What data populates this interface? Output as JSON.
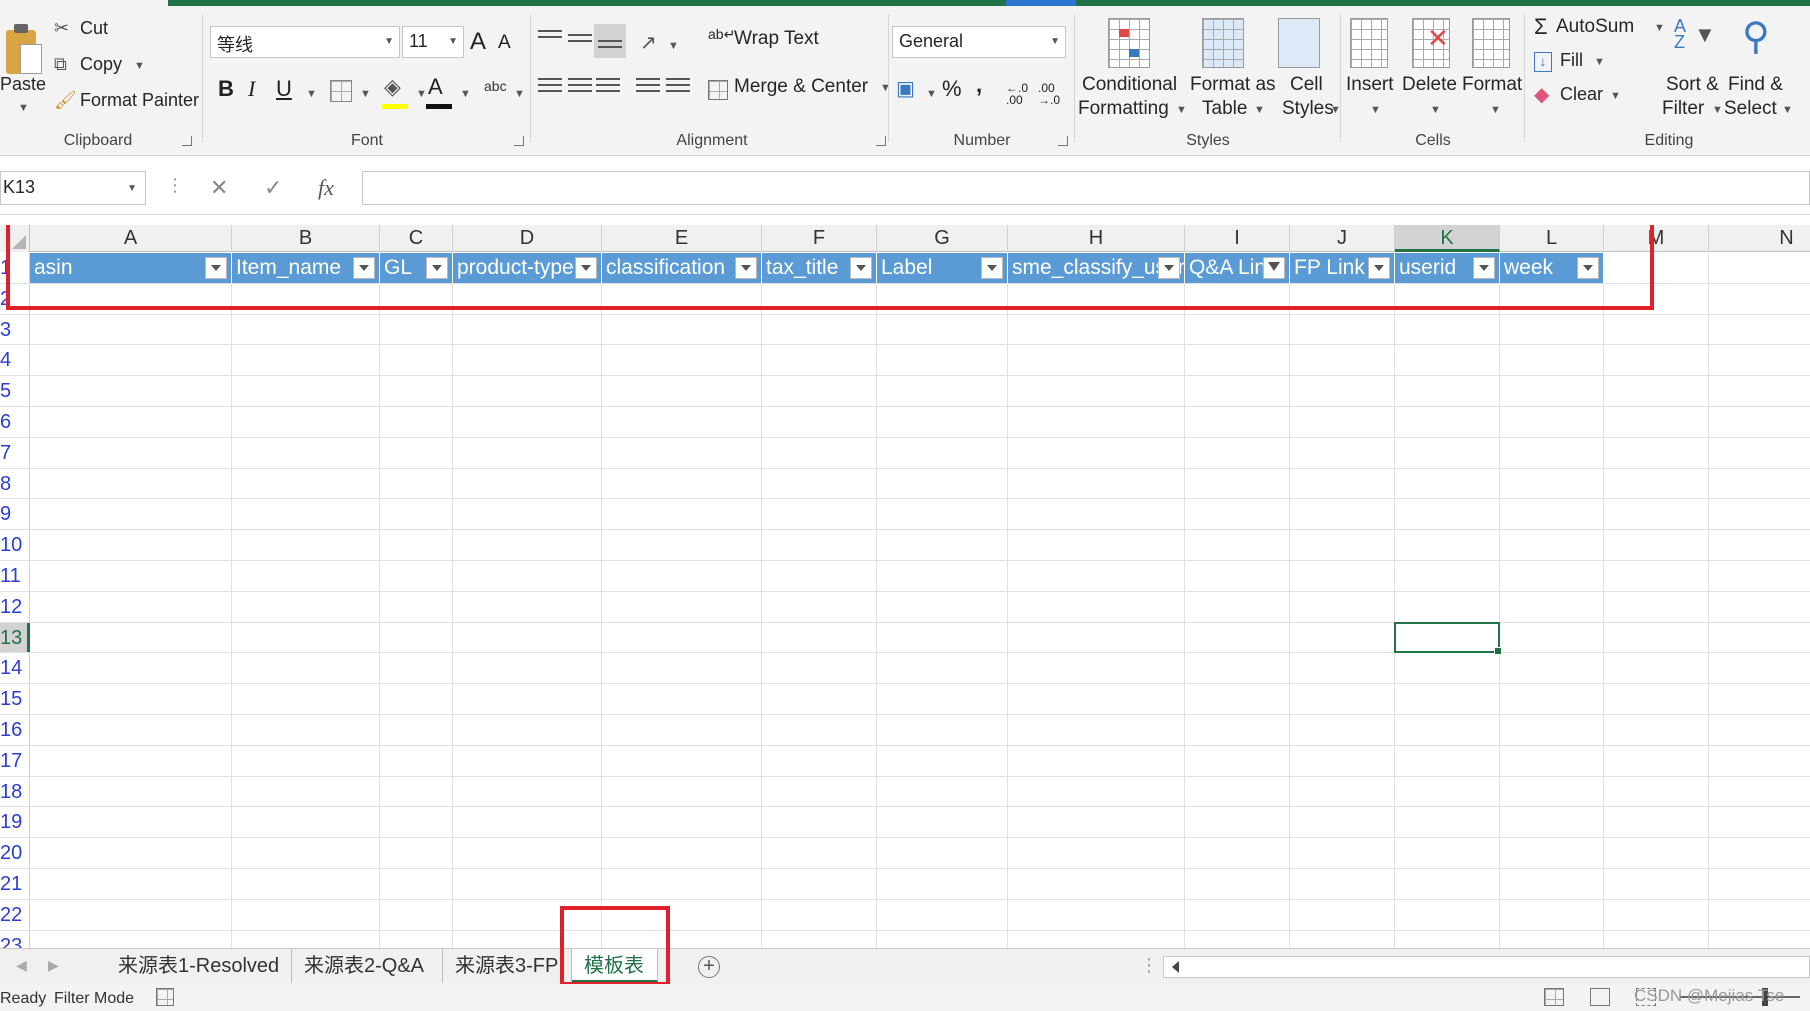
{
  "ribbon": {
    "clipboard": {
      "paste": "Paste",
      "cut": "Cut",
      "copy": "Copy",
      "format_painter": "Format Painter",
      "label": "Clipboard"
    },
    "font": {
      "name": "等线",
      "size": "11",
      "grow": "A",
      "shrink": "A",
      "bold": "B",
      "italic": "I",
      "underline": "U",
      "color_letter": "A",
      "phonetic": "abc",
      "label": "Font"
    },
    "alignment": {
      "wrap_text": "Wrap Text",
      "merge_center": "Merge & Center",
      "label": "Alignment"
    },
    "number": {
      "format": "General",
      "percent": "%",
      "comma": ",",
      "inc_decimal": "←.0 .00",
      "dec_decimal": ".00 →.0",
      "label": "Number"
    },
    "styles": {
      "conditional_1": "Conditional",
      "conditional_2": "Formatting",
      "format_table_1": "Format as",
      "format_table_2": "Table",
      "cell_styles_1": "Cell",
      "cell_styles_2": "Styles",
      "label": "Styles"
    },
    "cells": {
      "insert": "Insert",
      "delete": "Delete",
      "format": "Format",
      "label": "Cells"
    },
    "editing": {
      "autosum": "AutoSum",
      "fill": "Fill",
      "clear": "Clear",
      "sort_1": "Sort &",
      "sort_2": "Filter",
      "find_1": "Find &",
      "find_2": "Select",
      "label": "Editing"
    }
  },
  "formula_bar": {
    "name_box": "K13",
    "cancel": "✕",
    "enter": "✓",
    "fx": "fx",
    "formula": ""
  },
  "grid": {
    "columns": [
      "A",
      "B",
      "C",
      "D",
      "E",
      "F",
      "G",
      "H",
      "I",
      "J",
      "K",
      "L",
      "M",
      "N"
    ],
    "active_column": "K",
    "rows": [
      "1",
      "2",
      "3",
      "4",
      "5",
      "6",
      "7",
      "8",
      "9",
      "10",
      "11",
      "12",
      "13",
      "14",
      "15",
      "16",
      "17",
      "18",
      "19",
      "20",
      "21",
      "22",
      "23"
    ],
    "active_row": "13",
    "header_cells": [
      "asin",
      "Item_name",
      "GL",
      "product-type",
      "classification",
      "tax_title",
      "Label",
      "sme_classify_user",
      "Q&A Link",
      "FP Link",
      "userid",
      "week"
    ],
    "filtered_column": "I"
  },
  "sheet_tabs": {
    "tabs": [
      "来源表1-Resolved",
      "来源表2-Q&A",
      "来源表3-FP",
      "模板表"
    ],
    "active": "模板表",
    "add": "+"
  },
  "status_bar": {
    "ready": "Ready",
    "mode": "Filter Mode",
    "watermark": "CSDN @Mejias Tse"
  },
  "colors": {
    "header_fill": "#5b9bd5",
    "excel_green": "#217346",
    "annotation_red": "#e0202a",
    "row_number_blue": "#2b3ed1"
  }
}
